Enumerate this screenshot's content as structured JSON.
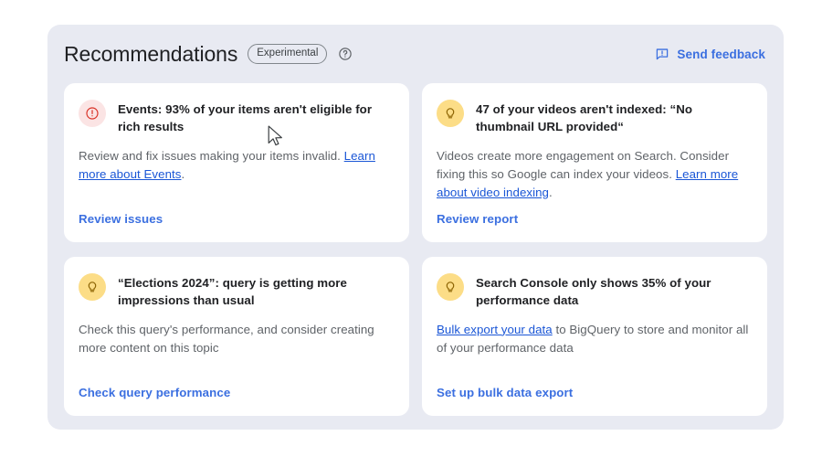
{
  "panel": {
    "title": "Recommendations",
    "chip_label": "Experimental",
    "help_icon": "help-circle-icon",
    "feedback_label": "Send feedback",
    "feedback_icon": "feedback-icon",
    "accent_link_color": "#3b6fe0",
    "inline_link_color": "#1a56d6",
    "background_color": "#e8eaf2",
    "card_background_color": "#ffffff"
  },
  "cards": [
    {
      "icon": "error-circle-icon",
      "icon_kind": "error",
      "icon_bg_color": "#fbe4e4",
      "icon_fg_color": "#d93025",
      "title": "Events: 93% of your items aren't eligible for rich results",
      "body_before": "Review and fix issues making your items invalid. ",
      "body_link": "Learn more about Events",
      "body_after": ".",
      "action": "Review issues"
    },
    {
      "icon": "lightbulb-icon",
      "icon_kind": "tip",
      "icon_bg_color": "#fcdd87",
      "icon_fg_color": "#8a6100",
      "title": "47 of your videos aren't indexed: “No thumbnail URL provided“",
      "body_before": "Videos create more engagement on Search. Consider fixing this so Google can index your videos. ",
      "body_link": "Learn more about video indexing",
      "body_after": ".",
      "action": "Review report"
    },
    {
      "icon": "lightbulb-icon",
      "icon_kind": "tip",
      "icon_bg_color": "#fcdd87",
      "icon_fg_color": "#8a6100",
      "title": "“Elections 2024”: query is getting more impressions than usual",
      "body_before": "Check this query's performance, and consider creating more content on this topic",
      "body_link": "",
      "body_after": "",
      "action": "Check query performance"
    },
    {
      "icon": "lightbulb-icon",
      "icon_kind": "tip",
      "icon_bg_color": "#fcdd87",
      "icon_fg_color": "#8a6100",
      "title": "Search Console only shows 35% of your performance data",
      "body_before": "",
      "body_link": "Bulk export your data",
      "body_after": " to BigQuery to store and monitor all of your performance data",
      "action": "Set up bulk data export"
    }
  ]
}
